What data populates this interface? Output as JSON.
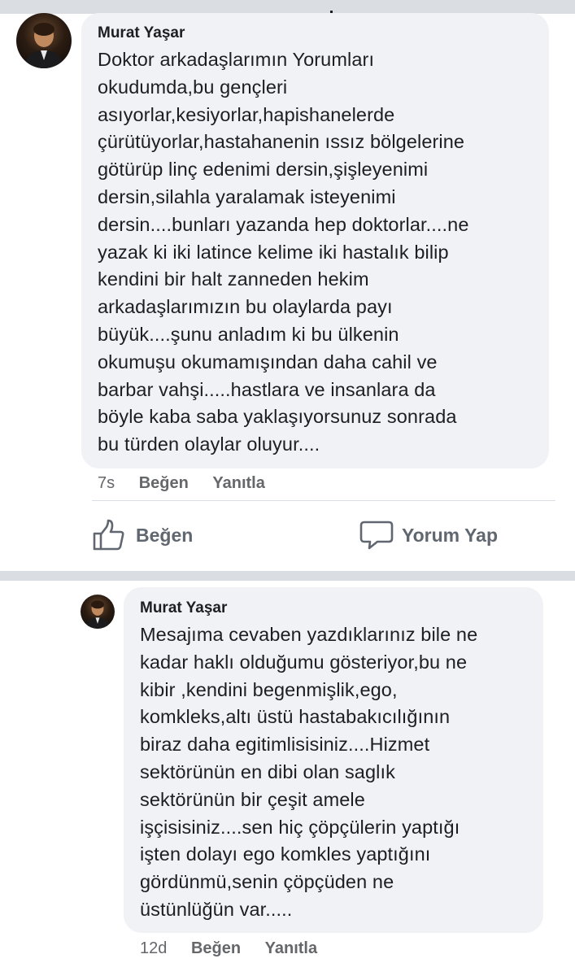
{
  "post_comment": {
    "author": "Murat Yaşar",
    "body": "Doktor arkadaşlarımın Yorumları\nokudumda,bu gençleri\nasıyorlar,kesiyorlar,hapishanelerde\nçürütüyorlar,hastahanenin ıssız bölgelerine\ngötürüp linç edenimi dersin,şişleyenimi\ndersin,silahla yaralamak isteyenimi\ndersin....bunları yazanda hep doktorlar....ne\nyazak ki iki latince kelime iki hastalık bilip\nkendini bir halt zanneden hekim\narkadaşlarımızın bu olaylarda payı\nbüyük....şunu anladım ki bu ülkenin\nokumuşu okumamışından daha cahil ve\nbarbar vahşi.....hastlara ve insanlara da\nböyle kaba saba yaklaşıyorsunuz sonrada\nbu türden olaylar oluyur....",
    "time": "7s",
    "like_label": "Beğen",
    "reply_label": "Yanıtla"
  },
  "actions": {
    "like_label": "Beğen",
    "comment_label": "Yorum Yap"
  },
  "reply_comment": {
    "author": "Murat Yaşar",
    "body": "Mesajıma cevaben yazdıklarınız bile ne\nkadar haklı olduğumu gösteriyor,bu ne\nkibir ,kendini begenmişlik,ego,\nkomkleks,altı üstü hastabakıcılığının\nbiraz daha egitimlisisiniz....Hizmet\nsektörünün en dibi olan saglık\nsektörünün bir çeşit amele\nişçisisiniz....sen hiç çöpçülerin yaptığı\nişten dolayı ego komkles yaptığını\ngördünmü,senin çöpçüden ne\nüstünlüğün var.....",
    "time": "12d",
    "like_label": "Beğen",
    "reply_label": "Yanıtla"
  },
  "colors": {
    "bubble": "#f0f2f5",
    "text": "#1c1e21",
    "meta": "#65676b",
    "action": "#606770",
    "separator": "#dadde1"
  },
  "icons": {
    "like": "thumbs-up-icon",
    "comment": "speech-bubble-icon",
    "avatar": "avatar"
  }
}
